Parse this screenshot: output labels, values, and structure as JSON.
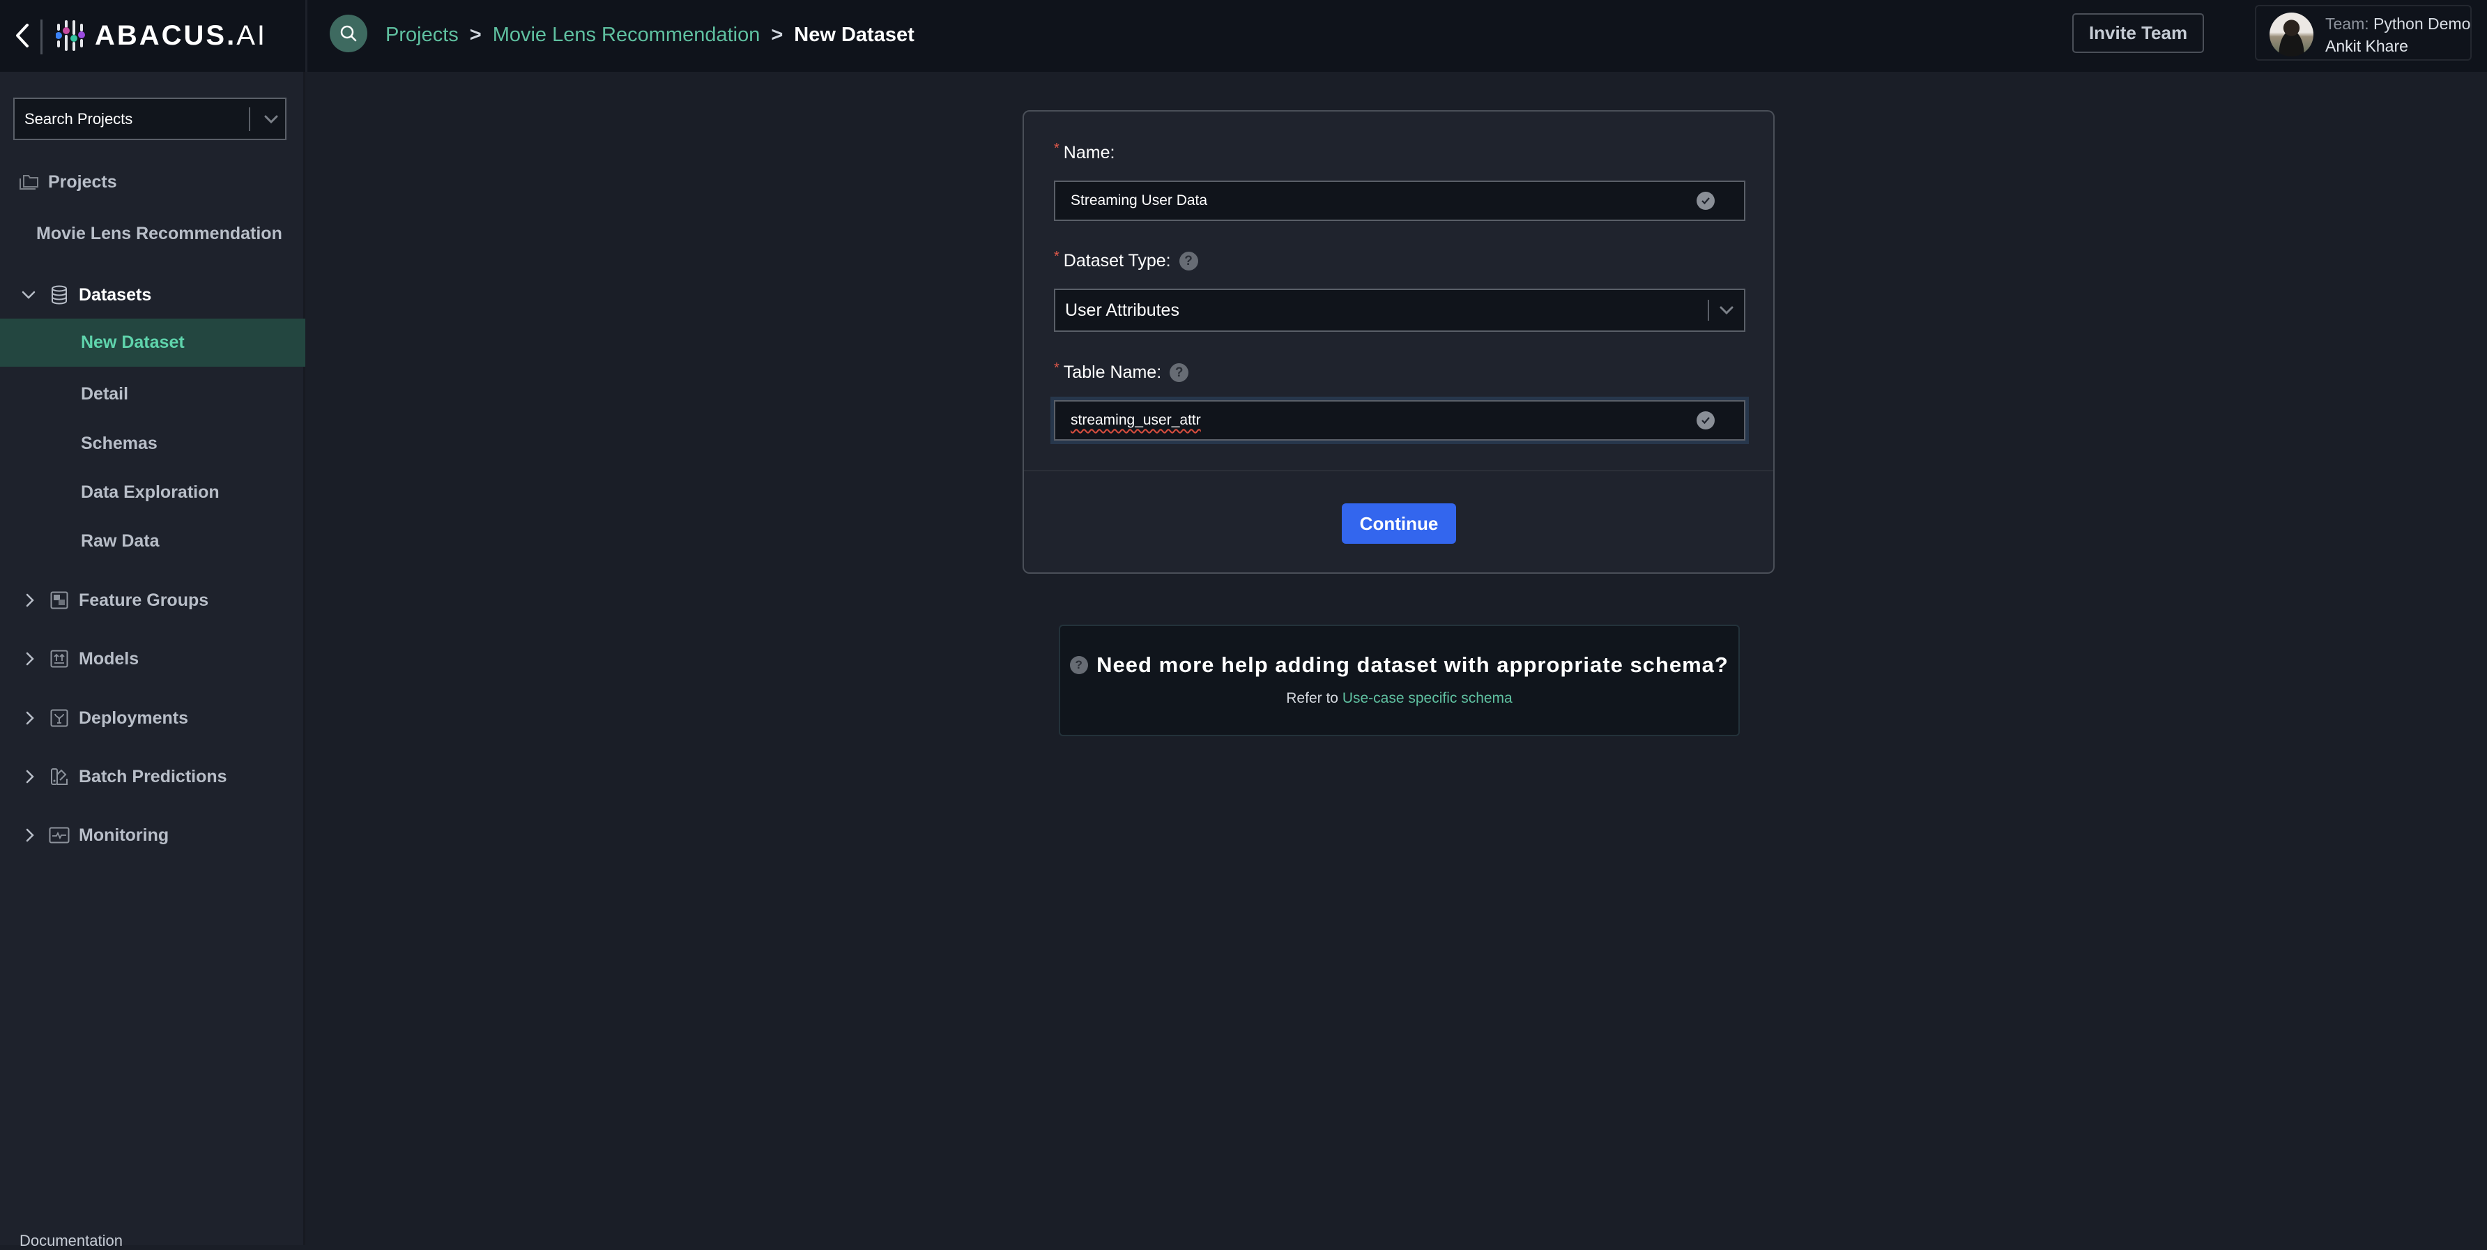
{
  "brand": {
    "logo_text": "ABACUS.",
    "logo_suffix": "AI",
    "dot_colors": [
      "#3b82f6",
      "#c64ba0",
      "#34c3a0",
      "#9b4be0"
    ]
  },
  "header": {
    "breadcrumb": [
      {
        "label": "Projects",
        "link": true
      },
      {
        "label": "Movie Lens Recommendation",
        "link": true
      },
      {
        "label": "New Dataset",
        "link": false
      }
    ],
    "separator": ">",
    "invite_button": "Invite Team",
    "profile": {
      "team_prefix": "Team:",
      "team_name": "Python Demo",
      "user_name": "Ankit Khare"
    }
  },
  "sidebar": {
    "search_placeholder": "Search Projects",
    "projects_label": "Projects",
    "project_name": "Movie Lens Recommendation",
    "sections": [
      {
        "label": "Datasets",
        "icon": "database-icon",
        "expanded": true
      },
      {
        "label": "Feature Groups",
        "icon": "feature-groups-icon",
        "expanded": false
      },
      {
        "label": "Models",
        "icon": "models-icon",
        "expanded": false
      },
      {
        "label": "Deployments",
        "icon": "deployments-icon",
        "expanded": false
      },
      {
        "label": "Batch Predictions",
        "icon": "batch-predictions-icon",
        "expanded": false
      },
      {
        "label": "Monitoring",
        "icon": "monitoring-icon",
        "expanded": false
      }
    ],
    "dataset_subitems": [
      {
        "label": "New Dataset",
        "active": true
      },
      {
        "label": "Detail",
        "active": false
      },
      {
        "label": "Schemas",
        "active": false
      },
      {
        "label": "Data Exploration",
        "active": false
      },
      {
        "label": "Raw Data",
        "active": false
      }
    ],
    "documentation": "Documentation"
  },
  "form": {
    "name": {
      "label": "Name:",
      "value": "Streaming User Data",
      "required": true
    },
    "dataset_type": {
      "label": "Dataset Type:",
      "value": "User Attributes",
      "required": true
    },
    "table_name": {
      "label": "Table Name:",
      "value": "streaming_user_attr",
      "required": true
    },
    "continue_button": "Continue",
    "required_marker": "*",
    "help_glyph": "?"
  },
  "help_box": {
    "title": "Need more help adding dataset with appropriate schema?",
    "prefix": "Refer to",
    "link_text": "Use-case specific schema"
  },
  "colors": {
    "accent_green": "#5fc0a0",
    "active_bg": "#234640",
    "primary_button": "#3366ee",
    "required": "#e0584a"
  }
}
